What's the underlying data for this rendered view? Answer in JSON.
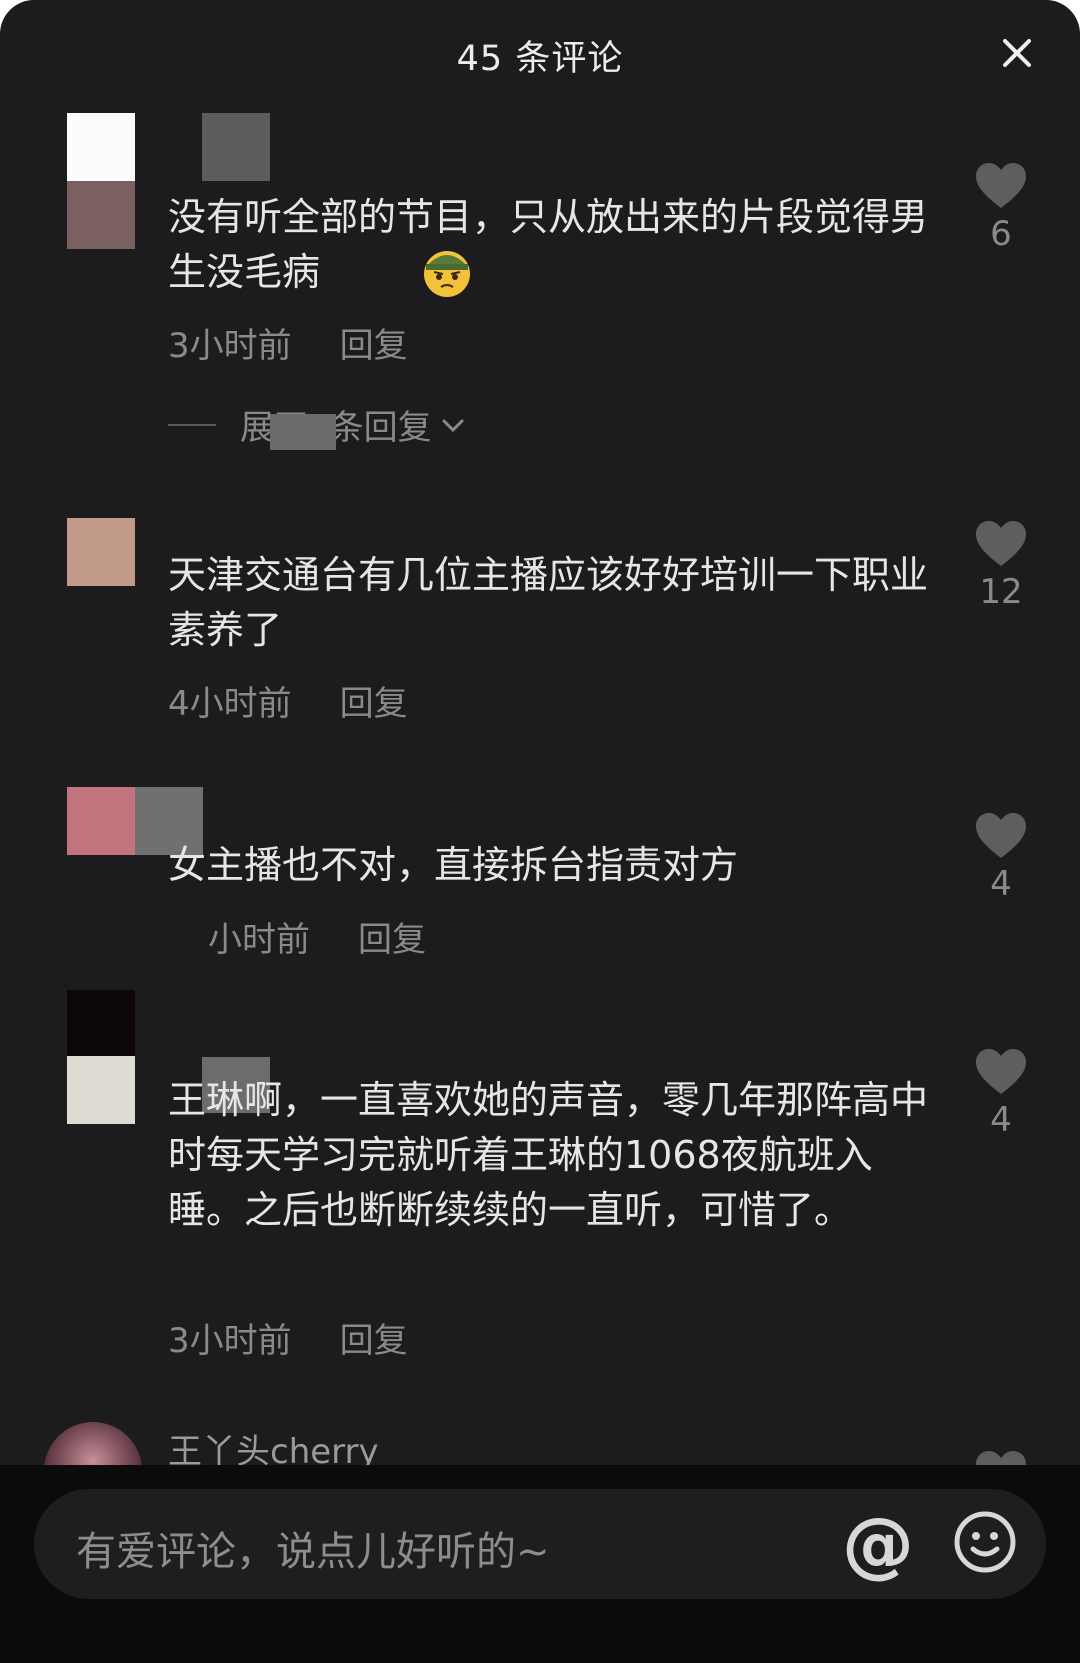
{
  "header": {
    "title": "45 条评论",
    "close_icon": "close-icon"
  },
  "comments": [
    {
      "username": "",
      "text": "没有听全部的节目，只从放出来的片段觉得男生没毛病",
      "time": "3小时前",
      "reply_label": "回复",
      "likes": "6",
      "expand_label": "展开4条回复"
    },
    {
      "username": "",
      "text": "天津交通台有几位主播应该好好培训一下职业素养了",
      "time": "4小时前",
      "reply_label": "回复",
      "likes": "12"
    },
    {
      "username": "",
      "text": "女主播也不对，直接拆台指责对方",
      "time": "小时前",
      "reply_label": "回复",
      "likes": "4"
    },
    {
      "username": "",
      "text": "王琳啊，一直喜欢她的声音，零几年那阵高中时每天学习完就听着王琳的1068夜航班入睡。之后也断断续续的一直听，可惜了。",
      "time": "3小时前",
      "reply_label": "回复",
      "likes": "4"
    },
    {
      "username": "王丫头cherry"
    }
  ],
  "composer": {
    "placeholder": "有爱评论，说点儿好听的~",
    "at_symbol": "@",
    "emoji_icon": "smiley-icon"
  },
  "colors": {
    "background": "#1c1c1e",
    "text": "#e6e6e6",
    "muted": "#8a8a8a",
    "bottom_bar": "#0b0b0c"
  }
}
